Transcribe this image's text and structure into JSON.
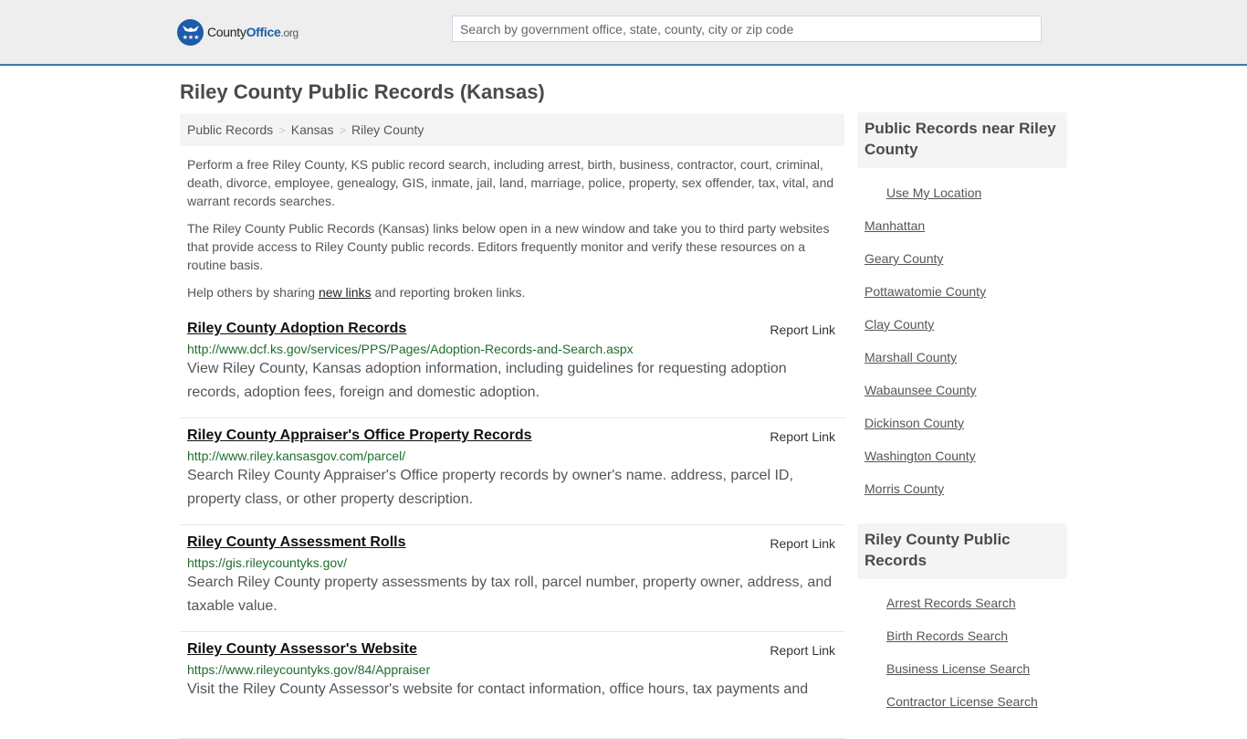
{
  "header": {
    "logo": {
      "county": "County",
      "office": "Office",
      "tld": ".org"
    },
    "search": {
      "placeholder": "Search by government office, state, county, city or zip code",
      "value": ""
    }
  },
  "page_title": "Riley County Public Records (Kansas)",
  "breadcrumb": [
    {
      "label": "Public Records"
    },
    {
      "label": "Kansas"
    },
    {
      "label": "Riley County"
    }
  ],
  "breadcrumb_separator": ">",
  "intro": {
    "p1": "Perform a free Riley County, KS public record search, including arrest, birth, business, contractor, court, criminal, death, divorce, employee, genealogy, GIS, inmate, jail, land, marriage, police, property, sex offender, tax, vital, and warrant records searches.",
    "p2": "The Riley County Public Records (Kansas) links below open in a new window and take you to third party websites that provide access to Riley County public records. Editors frequently monitor and verify these resources on a routine basis.",
    "p3_before": "Help others by sharing ",
    "p3_link": "new links",
    "p3_after": " and reporting broken links."
  },
  "records": [
    {
      "title": "Riley County Adoption Records",
      "report": "Report Link",
      "url": "http://www.dcf.ks.gov/services/PPS/Pages/Adoption-Records-and-Search.aspx",
      "desc": "View Riley County, Kansas adoption information, including guidelines for requesting adoption records, adoption fees, foreign and domestic adoption."
    },
    {
      "title": "Riley County Appraiser's Office Property Records",
      "report": "Report Link",
      "url": "http://www.riley.kansasgov.com/parcel/",
      "desc": "Search Riley County Appraiser's Office property records by owner's name. address, parcel ID, property class, or other property description."
    },
    {
      "title": "Riley County Assessment Rolls",
      "report": "Report Link",
      "url": "https://gis.rileycountyks.gov/",
      "desc": "Search Riley County property assessments by tax roll, parcel number, property owner, address, and taxable value."
    },
    {
      "title": "Riley County Assessor's Website",
      "report": "Report Link",
      "url": "https://www.rileycountyks.gov/84/Appraiser",
      "desc": "Visit the Riley County Assessor's website for contact information, office hours, tax payments and"
    }
  ],
  "sidebar": {
    "nearby": {
      "title": "Public Records near Riley County",
      "use_location": "Use My Location",
      "items": [
        "Manhattan",
        "Geary County",
        "Pottawatomie County",
        "Clay County",
        "Marshall County",
        "Wabaunsee County",
        "Dickinson County",
        "Washington County",
        "Morris County"
      ]
    },
    "county_records": {
      "title": "Riley County Public Records",
      "items": [
        "Arrest Records Search",
        "Birth Records Search",
        "Business License Search",
        "Contractor License Search"
      ]
    }
  }
}
